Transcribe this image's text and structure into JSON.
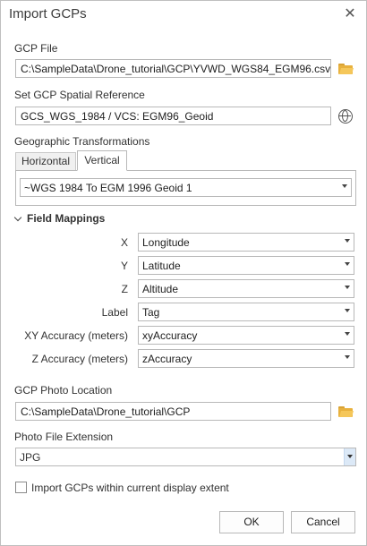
{
  "window": {
    "title": "Import GCPs"
  },
  "gcp_file": {
    "label": "GCP File",
    "value": "C:\\SampleData\\Drone_tutorial\\GCP\\YVWD_WGS84_EGM96.csv"
  },
  "spatial_reference": {
    "label": "Set GCP Spatial Reference",
    "value": "GCS_WGS_1984 / VCS: EGM96_Geoid"
  },
  "transformations": {
    "label": "Geographic Transformations",
    "tabs": [
      "Horizontal",
      "Vertical"
    ],
    "active_tab": "Vertical",
    "value": "~WGS 1984 To EGM 1996 Geoid 1"
  },
  "field_mappings": {
    "title": "Field Mappings",
    "rows": [
      {
        "label": "X",
        "value": "Longitude"
      },
      {
        "label": "Y",
        "value": "Latitude"
      },
      {
        "label": "Z",
        "value": "Altitude"
      },
      {
        "label": "Label",
        "value": "Tag"
      },
      {
        "label": "XY Accuracy (meters)",
        "value": "xyAccuracy"
      },
      {
        "label": "Z Accuracy (meters)",
        "value": "zAccuracy"
      }
    ]
  },
  "photo_location": {
    "label": "GCP Photo Location",
    "value": "C:\\SampleData\\Drone_tutorial\\GCP"
  },
  "photo_extension": {
    "label": "Photo File Extension",
    "value": "JPG"
  },
  "extent_option": {
    "label": "Import GCPs within current display extent",
    "checked": false
  },
  "buttons": {
    "ok": "OK",
    "cancel": "Cancel"
  }
}
